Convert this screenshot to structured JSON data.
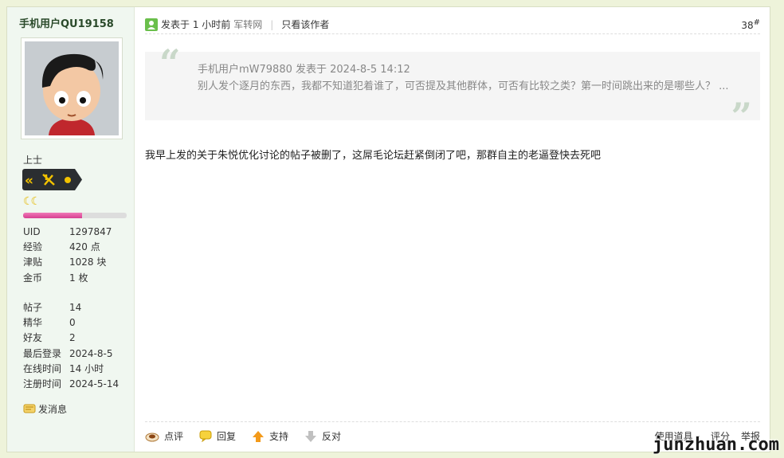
{
  "author": {
    "name": "手机用户QU19158",
    "rank": "上士",
    "moons": "☾☾",
    "level_progress": 0.57
  },
  "stats": [
    {
      "k": "UID",
      "v": "1297847"
    },
    {
      "k": "经验",
      "v": "420 点"
    },
    {
      "k": "津贴",
      "v": "1028 块"
    },
    {
      "k": "金币",
      "v": "1 枚"
    }
  ],
  "stats2": [
    {
      "k": "帖子",
      "v": "14"
    },
    {
      "k": "精华",
      "v": "0"
    },
    {
      "k": "好友",
      "v": "2"
    },
    {
      "k": "最后登录",
      "v": "2024-8-5"
    },
    {
      "k": "在线时间",
      "v": "14 小时"
    },
    {
      "k": "注册时间",
      "v": "2024-5-14"
    }
  ],
  "send_message": "发消息",
  "header": {
    "posted": "发表于 1 小时前",
    "source": "军转网",
    "only_author": "只看该作者",
    "floor": "38",
    "floor_mark": "#"
  },
  "quote": {
    "meta": "手机用户mW79880 发表于 2024-8-5 14:12",
    "body": "别人发个逐月的东西，我都不知道犯着谁了，可否提及其他群体，可否有比较之类？第一时间跳出来的是哪些人？ ..."
  },
  "content": "我早上发的关于朱悦优化讨论的帖子被删了，这屌毛论坛赶紧倒闭了吧，那群自主的老逼登快去死吧",
  "footer": {
    "comment": "点评",
    "reply": "回复",
    "support": "支持",
    "oppose": "反对",
    "tools": "使用道具",
    "rate": "评分",
    "report": "举报"
  },
  "watermark": "junzhuan.com"
}
